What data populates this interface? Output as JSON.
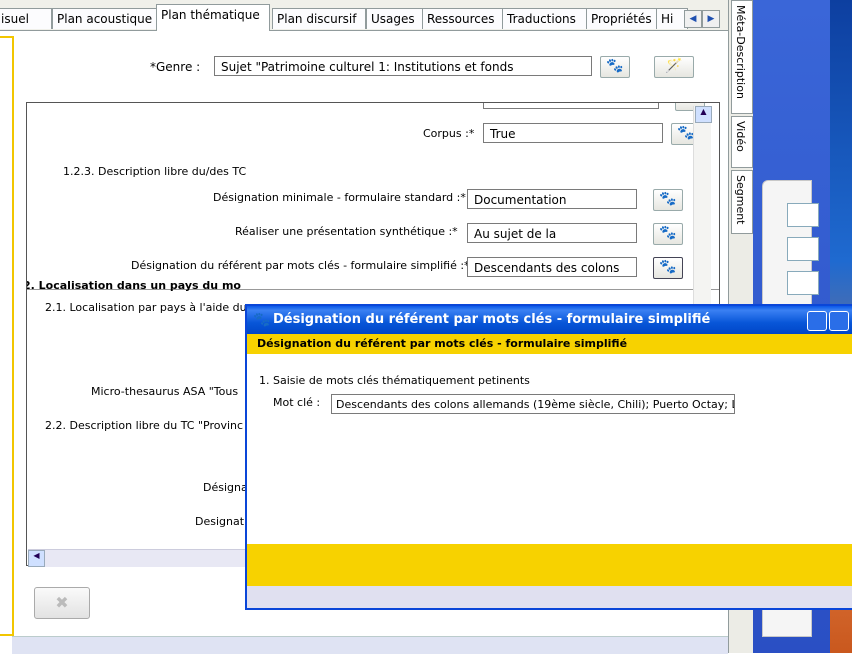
{
  "tabs": {
    "items": [
      "isuel",
      "Plan acoustique",
      "Plan thématique",
      "Plan discursif",
      "Usages",
      "Ressources",
      "Traductions",
      "Propriétés",
      "Hi"
    ],
    "active_index": 2,
    "scroll_left": "◀",
    "scroll_right": "▶"
  },
  "side_tabs": [
    "Méta-Description",
    "Vidéo",
    "Segment"
  ],
  "genre": {
    "label": "*Genre :",
    "value": "Sujet \"Patrimoine culturel 1: Institutions et fonds"
  },
  "form": {
    "corpus_label": "Corpus :*",
    "corpus_value": "True",
    "section_123": "1.2.3. Description libre du/des TC",
    "designation_min_label": "Désignation minimale - formulaire standard :*",
    "designation_min_value": "Documentation",
    "presentation_label": "Réaliser une présentation synthétique :*",
    "presentation_value": "Au sujet de la",
    "referent_label": "Désignation du référent par mots clés - formulaire simplifié :*",
    "referent_value": "Descendants des colons",
    "section_2": "2. Localisation dans un pays du mo",
    "section_21": "2.1. Localisation par pays à l'aide du",
    "micro_thesaurus": "Micro-thesaurus ASA \"Tous",
    "section_22": "2.2. Description libre du TC \"Provinc",
    "designa": "Désigna",
    "designati": "Designati"
  },
  "dialog": {
    "title": "Désignation du référent par mots clés - formulaire simplifié",
    "subtitle": "Désignation du référent par mots clés - formulaire simplifié",
    "section": "1. Saisie de mots clés thématiquement petinents",
    "keyword_label": "Mot clé :",
    "keyword_value": "Descendants des colons allemands (19ème siècle, Chili); Puerto Octay; L"
  },
  "colors": {
    "accent_yellow": "#f7d200",
    "title_blue": "#0a58e8"
  },
  "icons": {
    "paw": "🐾",
    "wand": "🪄",
    "puzzle": "✖"
  }
}
